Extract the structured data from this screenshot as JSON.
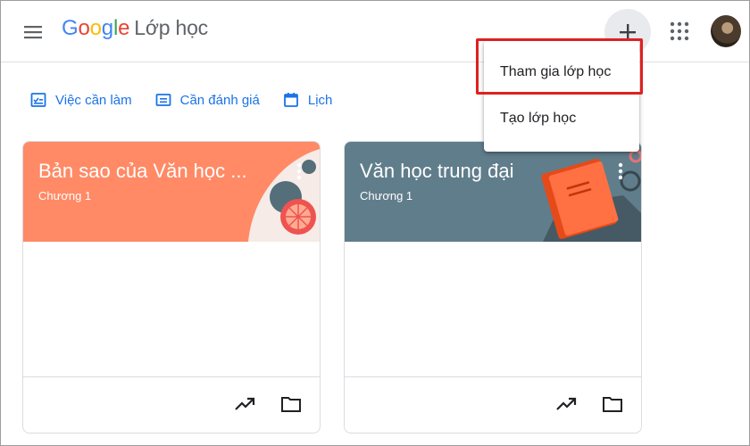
{
  "header": {
    "logo_letters": [
      "G",
      "o",
      "o",
      "g",
      "l",
      "e"
    ],
    "product_name": "Lớp học"
  },
  "icons": {
    "menu": "hamburger-menu-icon",
    "add": "plus-icon",
    "apps": "grid-apps-icon",
    "todo": "checklist-icon",
    "review": "inbox-icon",
    "calendar": "calendar-icon",
    "more": "vertical-dots-icon",
    "trend": "trending-up-icon",
    "folder": "folder-icon"
  },
  "subnav": {
    "todo": "Việc cần làm",
    "review": "Cần đánh giá",
    "calendar": "Lịch"
  },
  "cards": [
    {
      "title": "Bản sao của Văn học ...",
      "section": "Chương 1",
      "color": "#ff8a65"
    },
    {
      "title": "Văn học trung đại",
      "section": "Chương 1",
      "color": "#607d8b"
    }
  ],
  "dropdown": {
    "join": "Tham gia lớp học",
    "create": "Tạo lớp học"
  },
  "colors": {
    "accent": "#1a73e8",
    "highlight": "#e02020"
  }
}
